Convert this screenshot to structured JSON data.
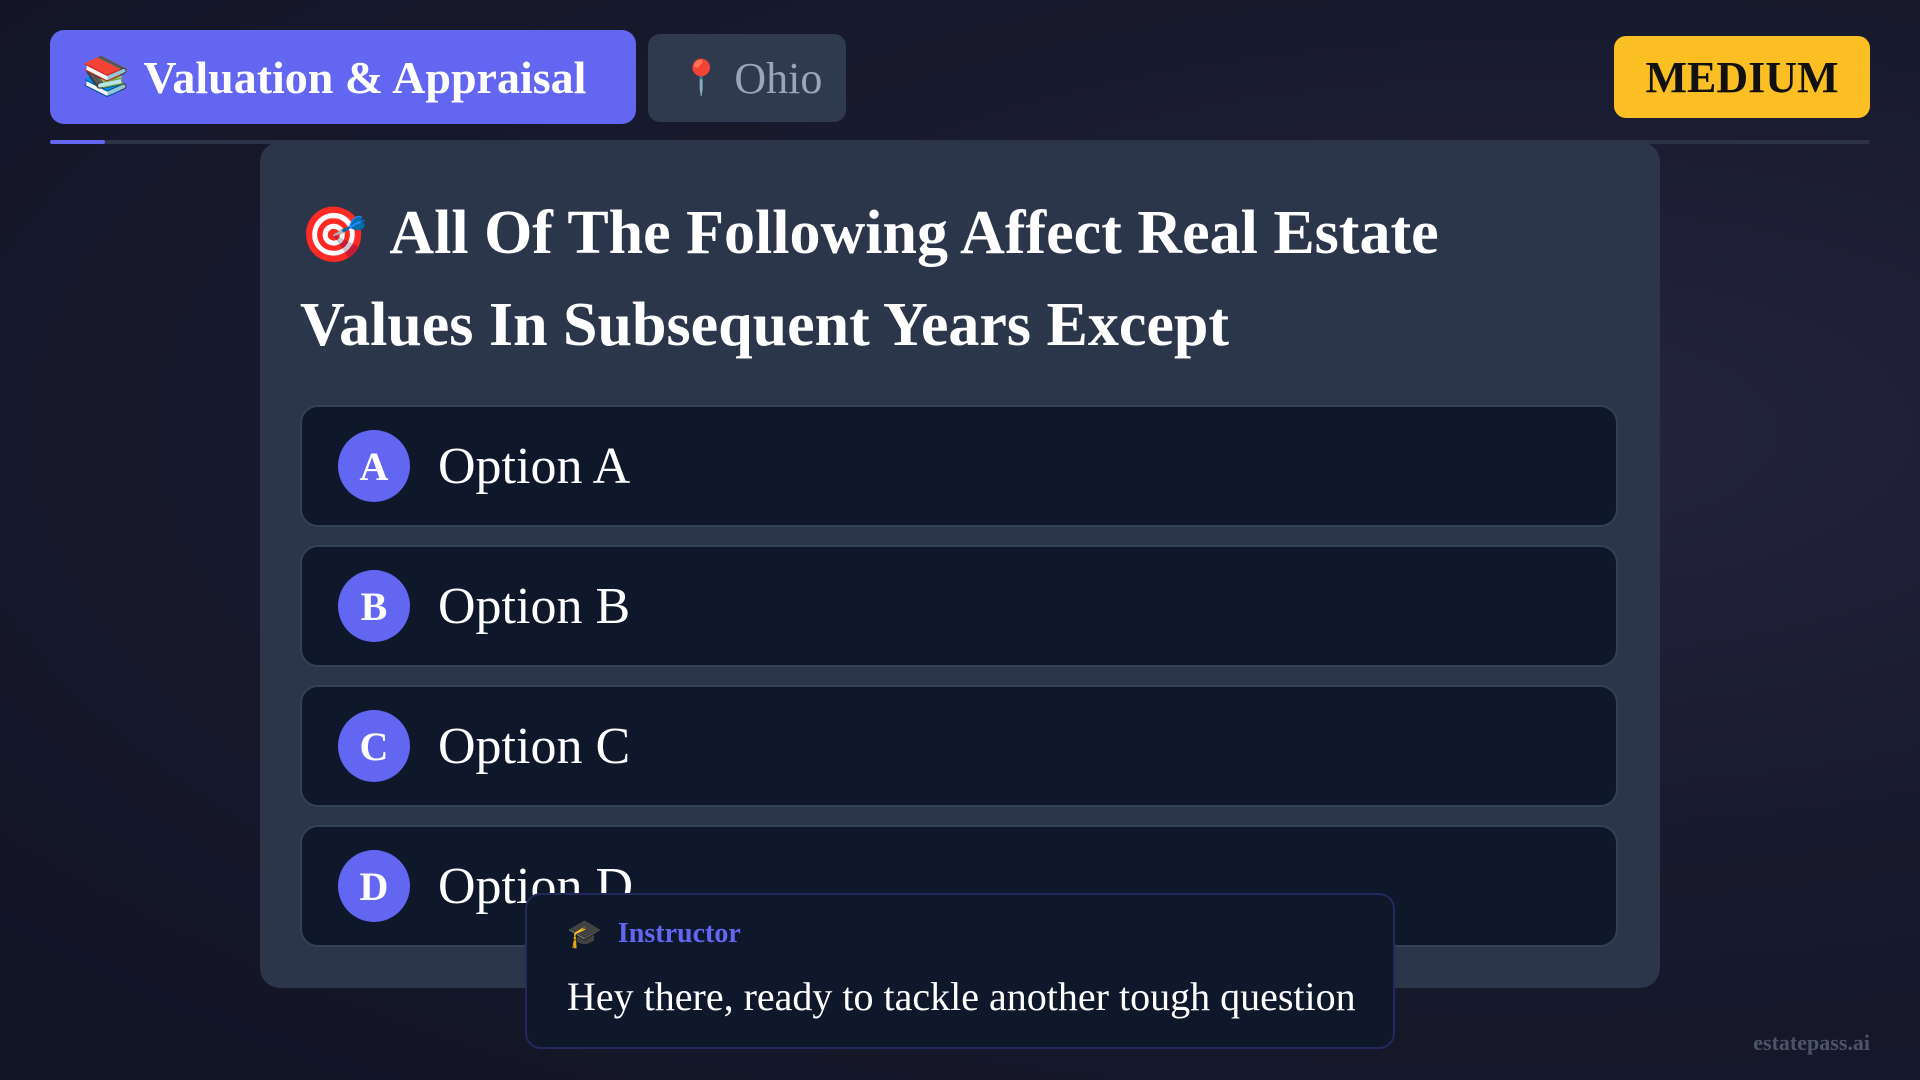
{
  "header": {
    "topic_icon": "📚",
    "topic_label": "Valuation & Appraisal",
    "state_icon": "📍",
    "state_label": "Ohio",
    "difficulty": "MEDIUM"
  },
  "progress": {
    "fraction": 0.03
  },
  "question": {
    "icon": "🎯",
    "text": "All Of The Following Affect Real Estate Values In Subsequent Years Except"
  },
  "options": [
    {
      "letter": "A",
      "label": "Option A"
    },
    {
      "letter": "B",
      "label": "Option B"
    },
    {
      "letter": "C",
      "label": "Option C"
    },
    {
      "letter": "D",
      "label": "Option D"
    }
  ],
  "instructor": {
    "icon": "🎓",
    "name": "Instructor",
    "message": "Hey there, ready to tackle another tough question"
  },
  "brand": "estatepass.ai",
  "colors": {
    "accent": "#6366f1",
    "badge": "#fbbf24",
    "card": "#2b364a",
    "option_bg": "#0f172a"
  }
}
